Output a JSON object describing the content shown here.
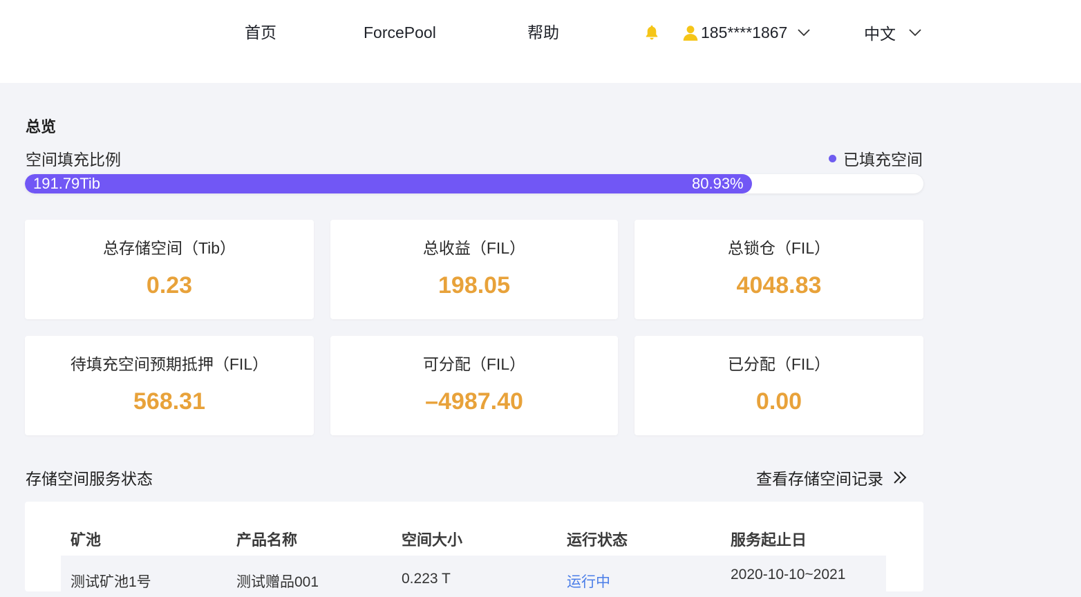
{
  "nav": {
    "home": "首页",
    "forcepool": "ForcePool",
    "help": "帮助",
    "user_phone": "185****1867",
    "language": "中文"
  },
  "overview": {
    "title": "总览",
    "fill_ratio_label": "空间填充比例",
    "legend_label": "已填充空间",
    "filled_amount": "191.79Tib",
    "filled_percent_text": "80.93%",
    "filled_fraction": 0.8093
  },
  "cards": [
    {
      "label": "总存储空间（Tib）",
      "value": "0.23"
    },
    {
      "label": "总收益（FIL）",
      "value": "198.05"
    },
    {
      "label": "总锁仓（FIL）",
      "value": "4048.83"
    },
    {
      "label": "待填充空间预期抵押（FIL）",
      "value": "568.31"
    },
    {
      "label": "可分配（FIL）",
      "value": "–4987.40"
    },
    {
      "label": "已分配（FIL）",
      "value": "0.00"
    }
  ],
  "status": {
    "title": "存储空间服务状态",
    "view_records": "查看存储空间记录",
    "columns": [
      "矿池",
      "产品名称",
      "空间大小",
      "运行状态",
      "服务起止日"
    ],
    "rows": [
      [
        "测试矿池1号",
        "测试赠品001",
        "0.223 T",
        "运行中",
        "2020-10-10~2021"
      ]
    ]
  },
  "colors": {
    "accent": "#7157f5",
    "value": "#e8a23a",
    "bell": "#f5c518",
    "link": "#4a7de8"
  }
}
